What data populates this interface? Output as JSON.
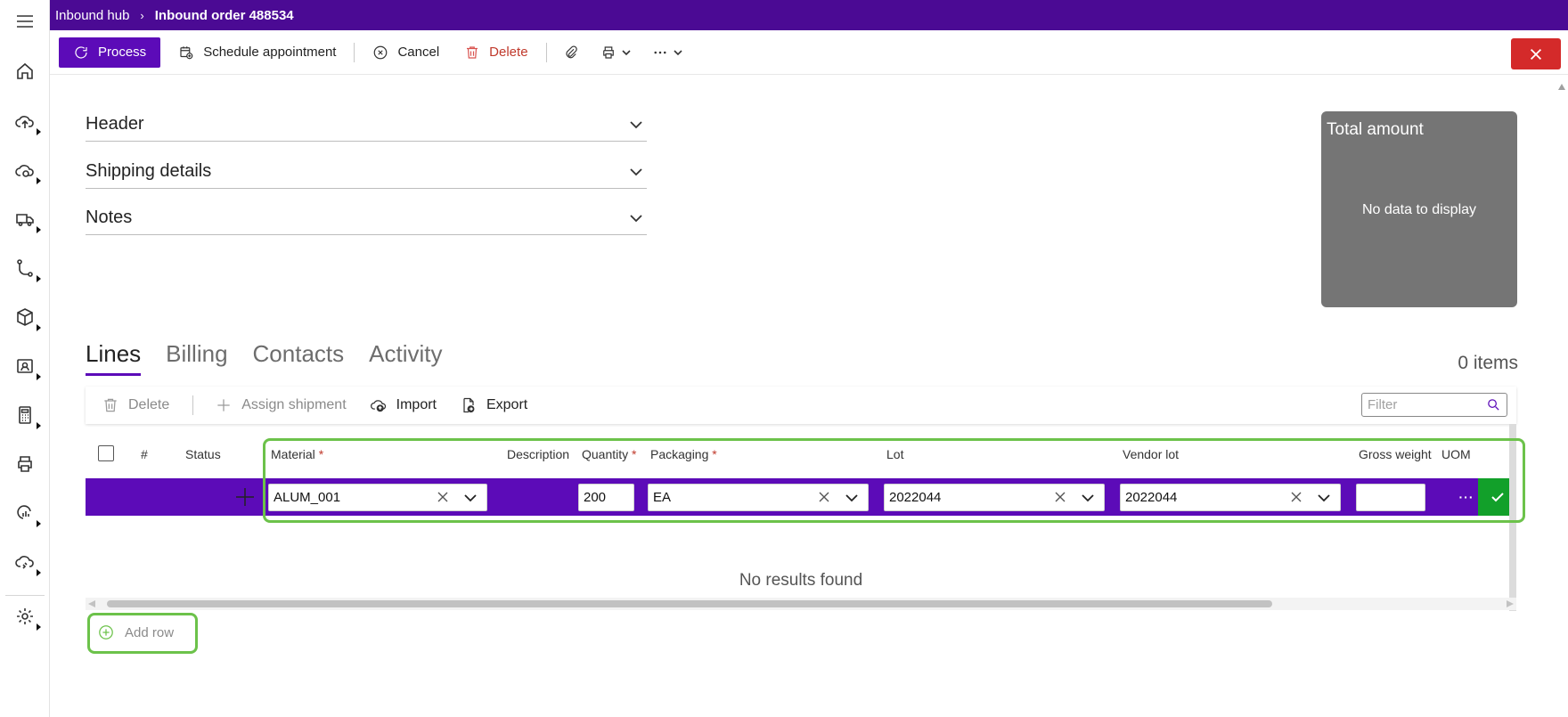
{
  "breadcrumb": {
    "parent": "Inbound hub",
    "separator": "›",
    "current": "Inbound order 488534"
  },
  "commands": {
    "process": "Process",
    "schedule": "Schedule appointment",
    "cancel": "Cancel",
    "delete": "Delete"
  },
  "sections": {
    "header": "Header",
    "shipping": "Shipping details",
    "notes": "Notes"
  },
  "total_card": {
    "title": "Total amount",
    "empty": "No data to display"
  },
  "tabs": [
    "Lines",
    "Billing",
    "Contacts",
    "Activity"
  ],
  "items_count": "0 items",
  "grid_toolbar": {
    "delete": "Delete",
    "assign_shipment": "Assign shipment",
    "import": "Import",
    "export": "Export",
    "filter_placeholder": "Filter"
  },
  "columns": {
    "number": "#",
    "status": "Status",
    "material": "Material",
    "description": "Description",
    "quantity": "Quantity",
    "packaging": "Packaging",
    "lot": "Lot",
    "vendor_lot": "Vendor lot",
    "gross_weight": "Gross weight",
    "uom": "UOM",
    "required_mark": "*"
  },
  "edit_row": {
    "material": "ALUM_001",
    "quantity": "200",
    "packaging": "EA",
    "lot": "2022044",
    "vendor_lot": "2022044",
    "gross_weight": "",
    "more": "···"
  },
  "empty_text": "No results found",
  "add_row": "Add row",
  "colors": {
    "brand": "#4b0a94",
    "primary": "#5c0bb8",
    "danger": "#d42a2a",
    "success": "#12a02a",
    "highlight": "#6cc24a"
  }
}
